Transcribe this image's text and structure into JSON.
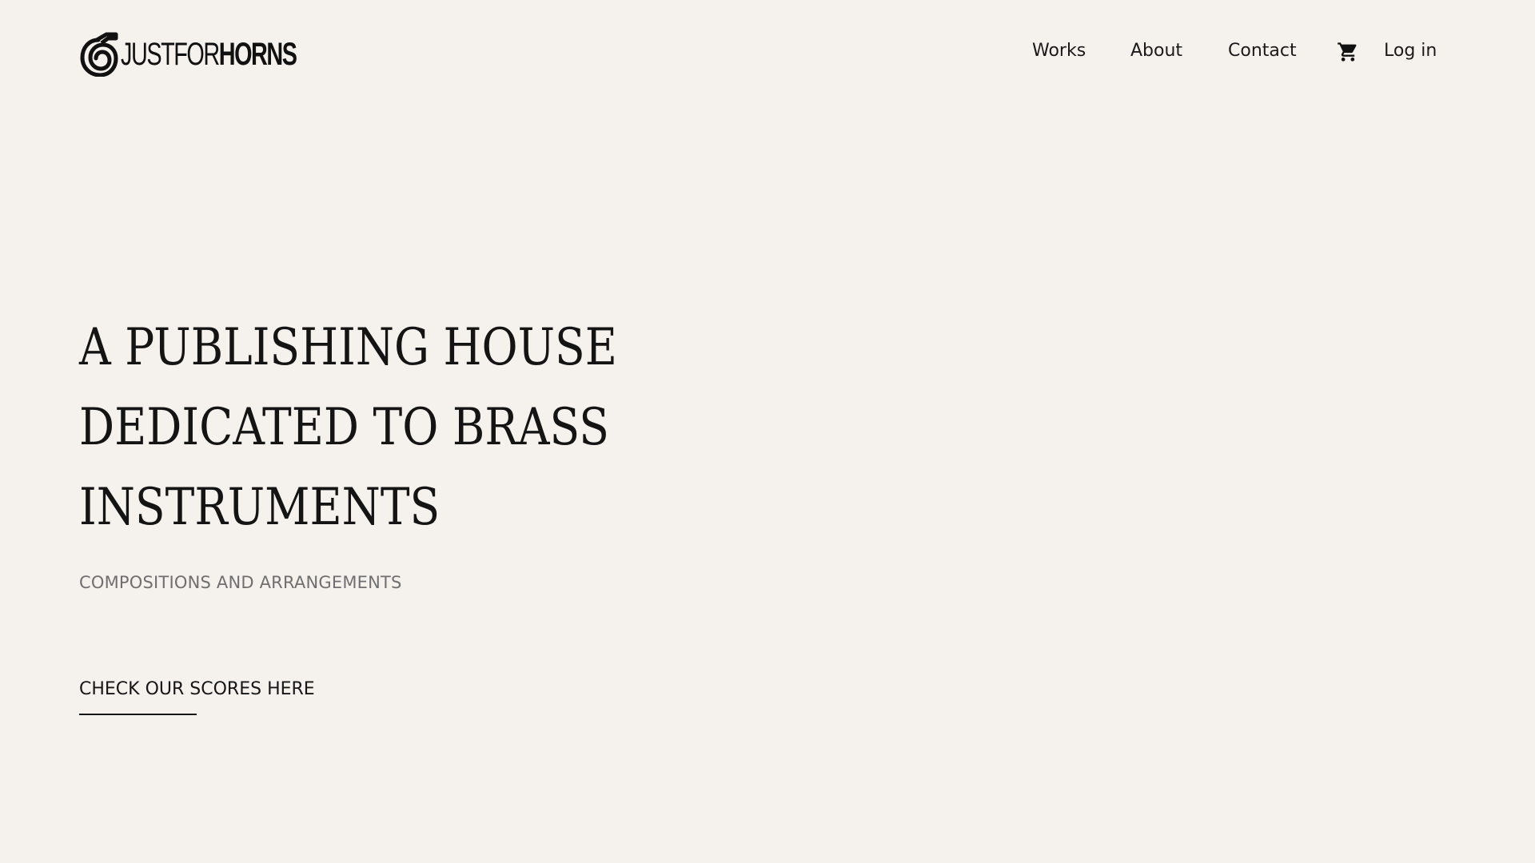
{
  "header": {
    "logo": {
      "text_light": "JUSTFOR",
      "text_bold": "HORNS",
      "icon": "french-horn-icon"
    },
    "nav": {
      "works": "Works",
      "about": "About",
      "contact": "Contact",
      "cart_icon": "shopping-cart-icon",
      "login": "Log in"
    }
  },
  "hero": {
    "title_lines": [
      "A PUBLISHING HOUSE",
      "DEDICATED TO BRASS",
      "INSTRUMENTS"
    ],
    "subtitle": "COMPOSITIONS AND ARRANGEMENTS",
    "cta": "CHECK OUR SCORES HERE"
  },
  "colors": {
    "background": "#f5f2ee",
    "text": "#161616",
    "subtitle": "#6f6f6f"
  }
}
